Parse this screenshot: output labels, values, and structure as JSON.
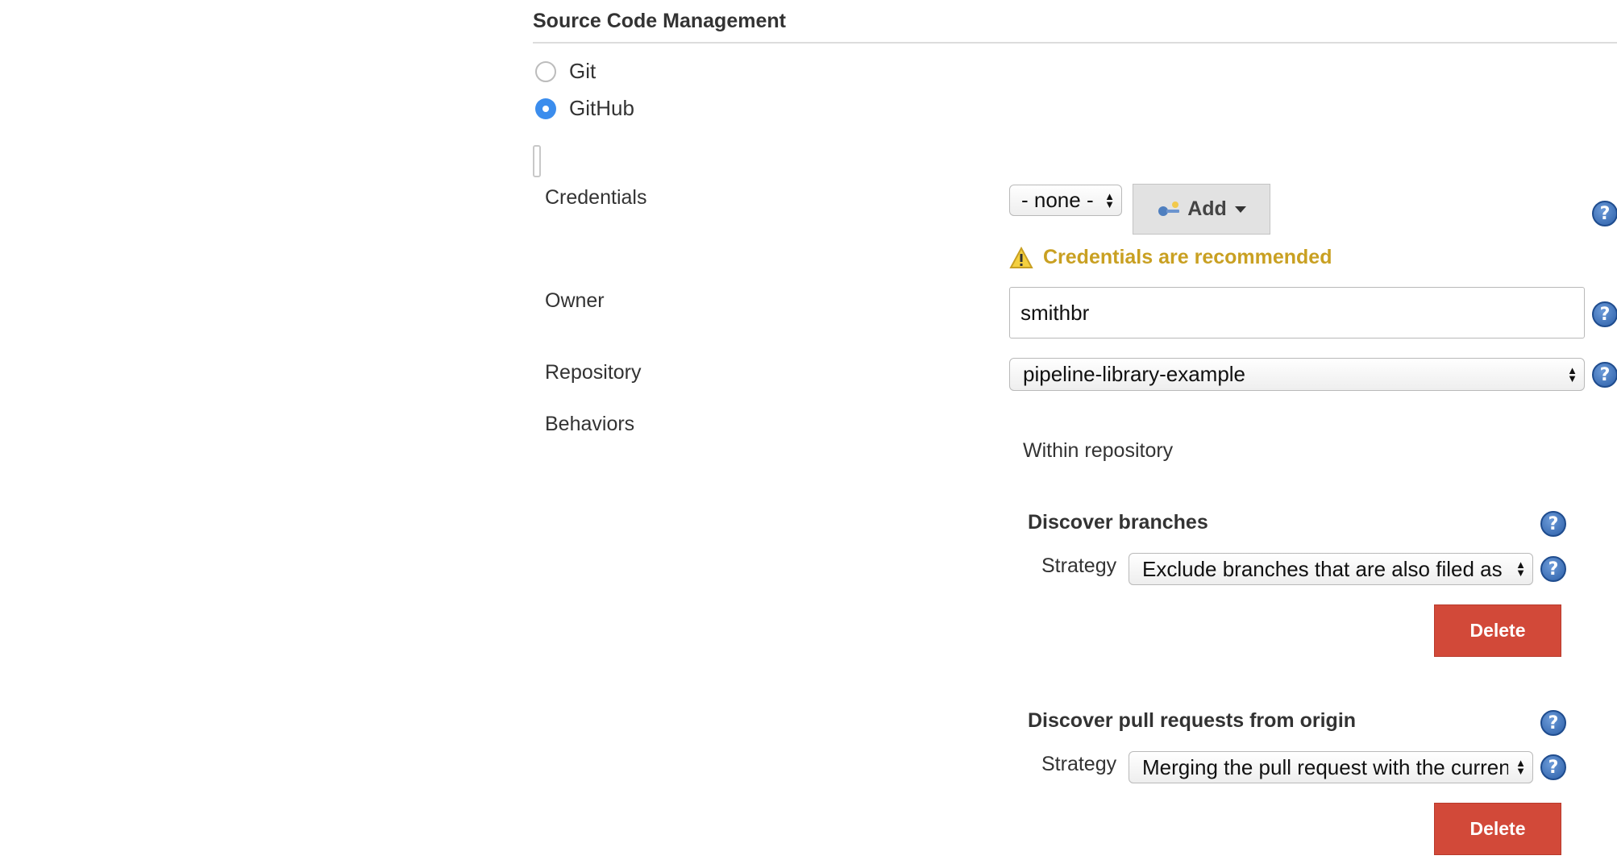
{
  "section": {
    "title": "Source Code Management"
  },
  "scm_options": [
    {
      "label": "Git",
      "selected": false
    },
    {
      "label": "GitHub",
      "selected": true
    }
  ],
  "fields": {
    "credentials": {
      "label": "Credentials",
      "select_value": "- none -",
      "add_button_label": "Add",
      "warning": "Credentials are recommended"
    },
    "owner": {
      "label": "Owner",
      "value": "smithbr"
    },
    "repository": {
      "label": "Repository",
      "select_value": "pipeline-library-example"
    },
    "behaviors": {
      "label": "Behaviors",
      "subheading": "Within repository"
    }
  },
  "traits": [
    {
      "title": "Discover branches",
      "strategy_label": "Strategy",
      "strategy_value": "Exclude branches that are also filed as",
      "delete_label": "Delete"
    },
    {
      "title": "Discover pull requests from origin",
      "strategy_label": "Strategy",
      "strategy_value": "Merging the pull request with the current",
      "delete_label": "Delete"
    }
  ],
  "help_icon_glyph": "?",
  "colors": {
    "radio_selected": "#3b8ded",
    "warning_text": "#c9a022",
    "delete_button": "#d24939",
    "help_icon": "#2c5fa8"
  },
  "icons": {
    "help": "help-icon",
    "warning": "warning-icon",
    "key": "key-icon",
    "dropdown": "chevron-down-icon"
  }
}
